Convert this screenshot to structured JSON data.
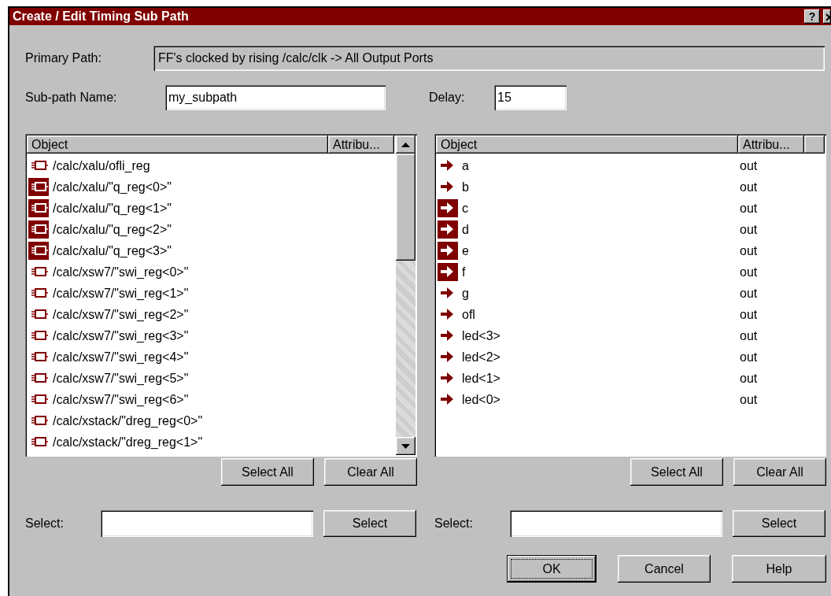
{
  "window": {
    "title": "Create / Edit Timing Sub Path",
    "help_button": "?"
  },
  "primary_path": {
    "label": "Primary Path:",
    "value": "FF's clocked by rising /calc/clk -> All Output Ports"
  },
  "subpath_name": {
    "label": "Sub-path Name:",
    "value": "my_subpath"
  },
  "delay": {
    "label": "Delay:",
    "value": "15"
  },
  "left_list": {
    "columns": [
      "Object",
      "Attribu..."
    ],
    "rows": [
      {
        "kind": "register",
        "object": "/calc/xalu/ofli_reg",
        "selected": false
      },
      {
        "kind": "register",
        "object": "/calc/xalu/\"q_reg<0>\"",
        "selected": true
      },
      {
        "kind": "register",
        "object": "/calc/xalu/\"q_reg<1>\"",
        "selected": true
      },
      {
        "kind": "register",
        "object": "/calc/xalu/\"q_reg<2>\"",
        "selected": true
      },
      {
        "kind": "register",
        "object": "/calc/xalu/\"q_reg<3>\"",
        "selected": true
      },
      {
        "kind": "register",
        "object": "/calc/xsw7/\"swi_reg<0>\"",
        "selected": false
      },
      {
        "kind": "register",
        "object": "/calc/xsw7/\"swi_reg<1>\"",
        "selected": false
      },
      {
        "kind": "register",
        "object": "/calc/xsw7/\"swi_reg<2>\"",
        "selected": false
      },
      {
        "kind": "register",
        "object": "/calc/xsw7/\"swi_reg<3>\"",
        "selected": false
      },
      {
        "kind": "register",
        "object": "/calc/xsw7/\"swi_reg<4>\"",
        "selected": false
      },
      {
        "kind": "register",
        "object": "/calc/xsw7/\"swi_reg<5>\"",
        "selected": false
      },
      {
        "kind": "register",
        "object": "/calc/xsw7/\"swi_reg<6>\"",
        "selected": false
      },
      {
        "kind": "register",
        "object": "/calc/xstack/\"dreg_reg<0>\"",
        "selected": false
      },
      {
        "kind": "register",
        "object": "/calc/xstack/\"dreg_reg<1>\"",
        "selected": false
      }
    ],
    "select_all": "Select All",
    "clear_all": "Clear All",
    "select_label": "Select:",
    "select_button": "Select"
  },
  "right_list": {
    "columns": [
      "Object",
      "Attribu..."
    ],
    "rows": [
      {
        "kind": "port",
        "object": "a",
        "attribute": "out",
        "selected": false
      },
      {
        "kind": "port",
        "object": "b",
        "attribute": "out",
        "selected": false
      },
      {
        "kind": "port",
        "object": "c",
        "attribute": "out",
        "selected": true
      },
      {
        "kind": "port",
        "object": "d",
        "attribute": "out",
        "selected": true
      },
      {
        "kind": "port",
        "object": "e",
        "attribute": "out",
        "selected": true
      },
      {
        "kind": "port",
        "object": "f",
        "attribute": "out",
        "selected": true
      },
      {
        "kind": "port",
        "object": "g",
        "attribute": "out",
        "selected": false
      },
      {
        "kind": "port",
        "object": "ofl",
        "attribute": "out",
        "selected": false
      },
      {
        "kind": "port",
        "object": "led<3>",
        "attribute": "out",
        "selected": false
      },
      {
        "kind": "port",
        "object": "led<2>",
        "attribute": "out",
        "selected": false
      },
      {
        "kind": "port",
        "object": "led<1>",
        "attribute": "out",
        "selected": false
      },
      {
        "kind": "port",
        "object": "led<0>",
        "attribute": "out",
        "selected": false
      }
    ],
    "select_all": "Select All",
    "clear_all": "Clear All",
    "select_label": "Select:",
    "select_button": "Select"
  },
  "buttons": [
    {
      "label": "OK",
      "default": true
    },
    {
      "label": "Cancel",
      "default": false
    },
    {
      "label": "Help",
      "default": false
    }
  ]
}
